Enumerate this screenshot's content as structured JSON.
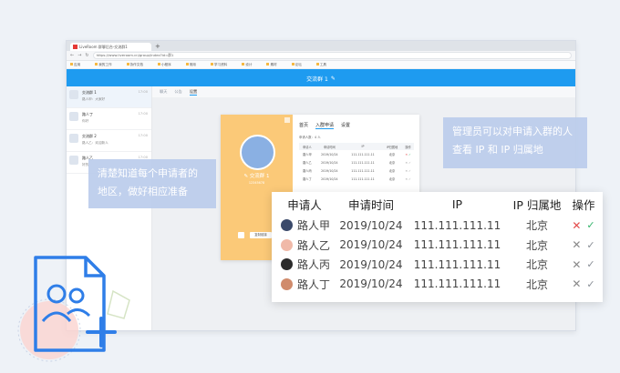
{
  "browser": {
    "tab_title": "LiveRoom 群聊后台-交流群1",
    "new_tab": "+",
    "url": "https://www.liveroom.cn/group/index?id=群1",
    "bookmarks": [
      "应用",
      "我的工作",
      "协作文档",
      "小程序",
      "常用",
      "学习资料",
      "设计",
      "素材",
      "论坛",
      "工具"
    ]
  },
  "app": {
    "title": "交流群 1",
    "edit_icon": "pencil-icon"
  },
  "sidebar": {
    "chats": [
      {
        "name": "交流群 1",
        "snippet": "路人甲：大家好",
        "time": "17:00",
        "active": true
      },
      {
        "name": "路人丁",
        "snippet": "你好",
        "time": "17:00",
        "active": false
      },
      {
        "name": "交流群 2",
        "snippet": "路人乙：欢迎新人",
        "time": "17:00",
        "active": false
      },
      {
        "name": "路人乙",
        "snippet": "好的",
        "time": "17:00",
        "active": false
      }
    ]
  },
  "subtabs": [
    "聊天",
    "公告",
    "设置"
  ],
  "group_card": {
    "name": "交流群 1",
    "id": "12345678",
    "button_label": "复制链接",
    "tabs": [
      "首页",
      "入群申请",
      "设置"
    ],
    "meta": "申请人数：4 人",
    "mini_headers": [
      "申请人",
      "申请时间",
      "IP",
      "IP归属地",
      "操作"
    ]
  },
  "tips": {
    "left": "清楚知道每个申请者的地区，做好相应准备",
    "right": "管理员可以对申请入群的人查看 IP 和 IP 归属地"
  },
  "table": {
    "headers": [
      "申请人",
      "申请时间",
      "IP",
      "IP 归属地",
      "操作"
    ],
    "rows": [
      {
        "name": "路人甲",
        "date": "2019/10/24",
        "ip": "111.111.111.11",
        "region": "北京",
        "avatar_color": "#3b4a6b"
      },
      {
        "name": "路人乙",
        "date": "2019/10/24",
        "ip": "111.111.111.11",
        "region": "北京",
        "avatar_color": "#f0b9a8"
      },
      {
        "name": "路人丙",
        "date": "2019/10/24",
        "ip": "111.111.111.11",
        "region": "北京",
        "avatar_color": "#2c2c2c"
      },
      {
        "name": "路人丁",
        "date": "2019/10/24",
        "ip": "111.111.111.11",
        "region": "北京",
        "avatar_color": "#d08b6c"
      }
    ],
    "reject_icon": "✕",
    "accept_icon": "✓"
  },
  "colors": {
    "primary": "#1e9bf0",
    "card_accent": "#fbc978",
    "tip_bg": "#bbccec",
    "reject": "#e34a4a",
    "accept": "#34b46c"
  }
}
